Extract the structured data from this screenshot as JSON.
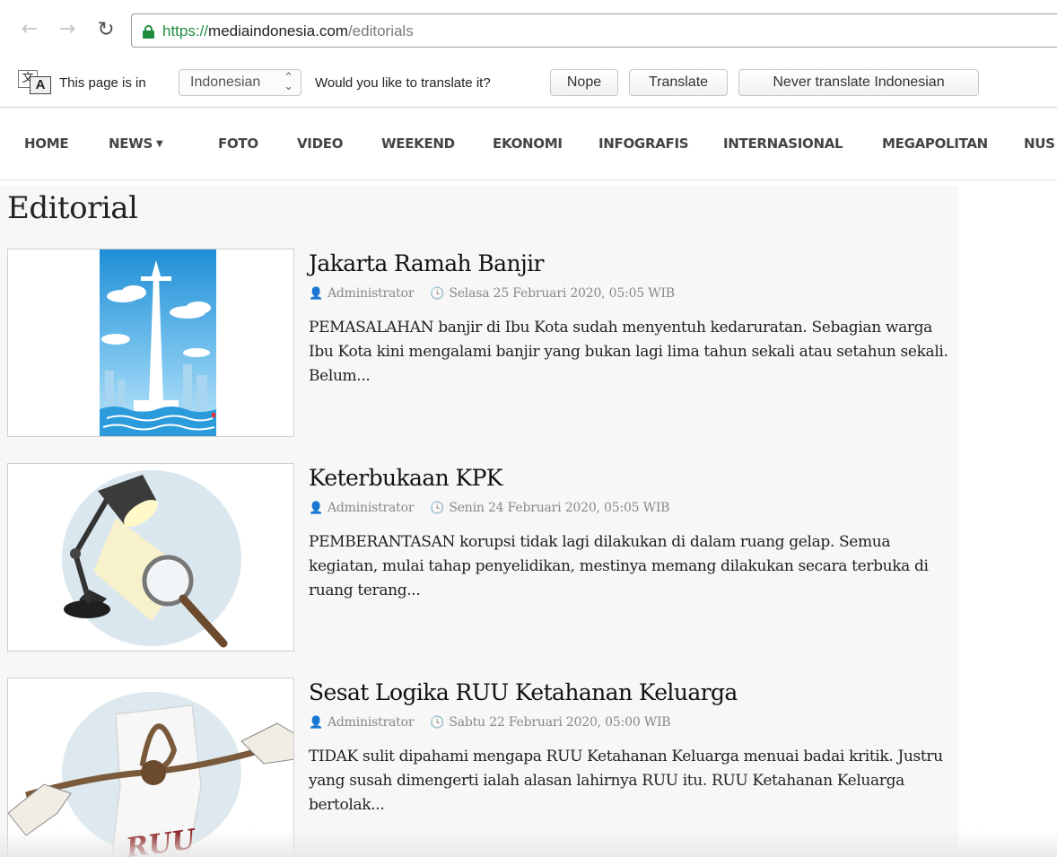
{
  "browser": {
    "url": {
      "scheme": "https://",
      "host": "mediaindonesia.com",
      "path": "/editorials"
    },
    "translate_bar": {
      "prefix": "This page is in",
      "language": "Indonesian",
      "question": "Would you like to translate it?",
      "nope_label": "Nope",
      "translate_label": "Translate",
      "never_label": "Never translate Indonesian"
    }
  },
  "nav": {
    "items": [
      "HOME",
      "NEWS",
      "FOTO",
      "VIDEO",
      "WEEKEND",
      "EKONOMI",
      "INFOGRAFIS",
      "INTERNASIONAL",
      "MEGAPOLITAN",
      "NUS"
    ]
  },
  "page": {
    "title": "Editorial"
  },
  "articles": [
    {
      "title": "Jakarta Ramah Banjir",
      "author": "Administrator",
      "date": "Selasa 25 Februari 2020, 05:05 WIB",
      "excerpt": "PEMASALAHAN banjir di Ibu Kota sudah menyentuh kedaruratan. Sebagian warga Ibu Kota kini mengalami banjir yang bukan lagi lima tahun sekali atau setahun sekali. Belum...",
      "image": "monas-flood-illustration"
    },
    {
      "title": "Keterbukaan KPK",
      "author": "Administrator",
      "date": "Senin 24 Februari 2020, 05:05 WIB",
      "excerpt": "PEMBERANTASAN korupsi tidak lagi dilakukan di dalam ruang gelap. Semua kegiatan, mulai tahap penyelidikan, mestinya memang dilakukan secara terbuka di ruang terang...",
      "image": "desk-lamp-magnifier-illustration"
    },
    {
      "title": "Sesat Logika RUU Ketahanan Keluarga",
      "author": "Administrator",
      "date": "Sabtu 22 Februari 2020, 05:00 WIB",
      "excerpt": "TIDAK sulit dipahami mengapa RUU Ketahanan Keluarga menuai badai kritik. Justru yang susah dimengerti ialah alasan lahirnya RUU itu. RUU Ketahanan Keluarga bertolak...",
      "image": "rope-knot-ruu-illustration",
      "image_text": "RUU"
    }
  ]
}
